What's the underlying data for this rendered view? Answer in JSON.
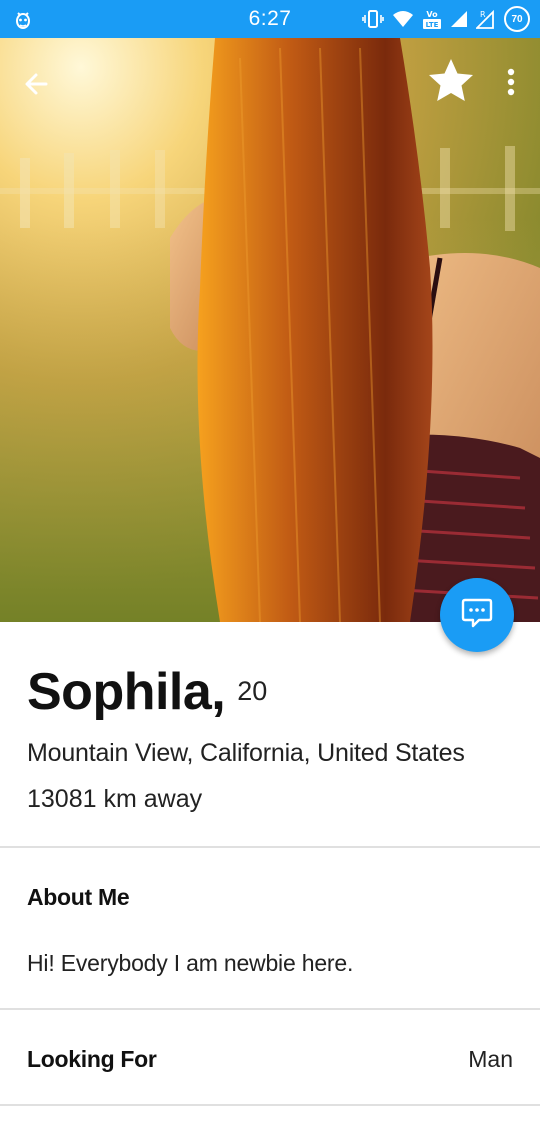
{
  "status_bar": {
    "time": "6:27",
    "battery_level": "70",
    "background_color": "#1a9cf5",
    "icons": [
      "bug-icon",
      "vibrate-icon",
      "wifi-icon",
      "volte-icon",
      "signal-icon",
      "signal-roaming-icon",
      "battery-icon"
    ]
  },
  "hero": {
    "back_icon": "arrow-left-icon",
    "favorite_icon": "star-icon",
    "more_icon": "more-vertical-icon"
  },
  "fab": {
    "icon": "chat-bubble-icon",
    "color": "#1a9cf5"
  },
  "profile": {
    "name": "Sophila,",
    "age": "20",
    "location": "Mountain View, California, United States",
    "distance": "13081 km away"
  },
  "about": {
    "title": "About Me",
    "text": "Hi! Everybody I am newbie here."
  },
  "looking_for": {
    "label": "Looking For",
    "value": "Man"
  }
}
